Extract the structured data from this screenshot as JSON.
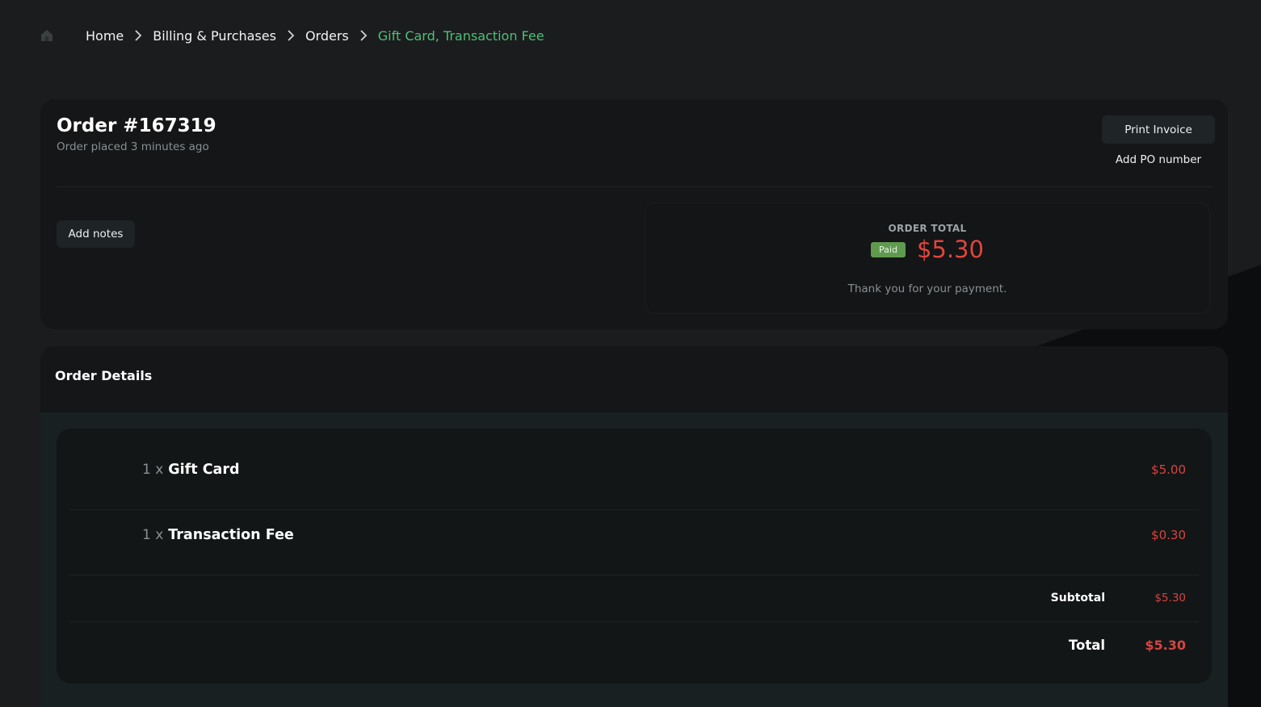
{
  "breadcrumb": {
    "items": [
      "Home",
      "Billing & Purchases",
      "Orders"
    ],
    "current": "Gift Card, Transaction Fee"
  },
  "order": {
    "title": "Order #167319",
    "placed": "Order placed 3 minutes ago",
    "print_label": "Print Invoice",
    "po_label": "Add PO number",
    "notes_label": "Add notes",
    "total_label": "ORDER TOTAL",
    "status": "Paid",
    "total": "$5.30",
    "thanks": "Thank you for your payment."
  },
  "details": {
    "title": "Order Details",
    "items": [
      {
        "qty": "1 x",
        "name": "Gift Card",
        "price": "$5.00"
      },
      {
        "qty": "1 x",
        "name": "Transaction Fee",
        "price": "$0.30"
      }
    ],
    "subtotal_label": "Subtotal",
    "subtotal": "$5.30",
    "total_label": "Total",
    "total": "$5.30"
  },
  "colors": {
    "accent": "#4fbf77",
    "price": "#d8443f",
    "paid": "#5f9a4f",
    "card": "#141617"
  },
  "icons": {
    "home": "home-icon",
    "separator": "chevron-right-icon"
  }
}
